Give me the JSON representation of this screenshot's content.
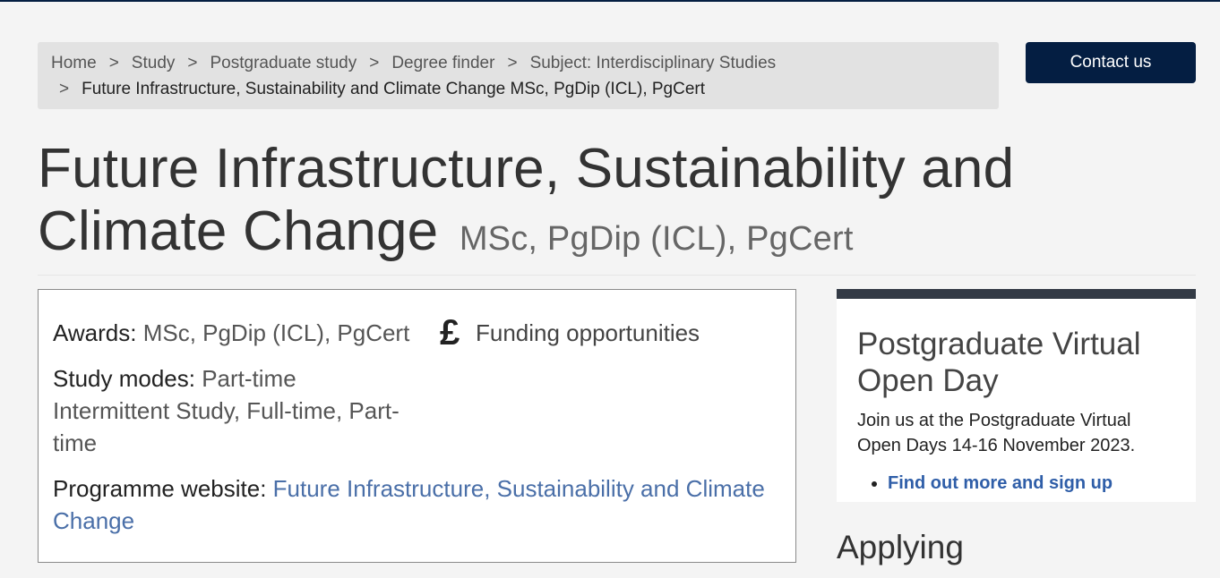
{
  "breadcrumb": {
    "items": [
      "Home",
      "Study",
      "Postgraduate study",
      "Degree finder",
      "Subject: Interdisciplinary Studies"
    ],
    "separator": ">",
    "current": "Future Infrastructure, Sustainability and Climate Change MSc, PgDip (ICL), PgCert"
  },
  "header": {
    "contact_label": "Contact us"
  },
  "page": {
    "title": "Future Infrastructure, Sustainability and Climate Change",
    "awards_suffix": "MSc, PgDip (ICL), PgCert"
  },
  "info": {
    "awards_label": "Awards:",
    "awards_value": "MSc, PgDip (ICL), PgCert",
    "modes_label": "Study modes:",
    "modes_value": "Part-time Intermittent Study, Full-time, Part-time",
    "website_label": "Programme website:",
    "website_link": "Future Infrastructure, Sustainability and Climate Change",
    "funding_label": "Funding opportunities",
    "funding_icon": "pound-icon"
  },
  "sidebar": {
    "openday_title": "Postgraduate Virtual Open Day",
    "openday_text": "Join us at the Postgraduate Virtual Open Days 14-16 November 2023.",
    "openday_link": "Find out more and sign up",
    "applying_heading": "Applying"
  },
  "colors": {
    "brand_navy": "#041e42",
    "link": "#4a6fa8",
    "sidebar_bar": "#333a45"
  }
}
